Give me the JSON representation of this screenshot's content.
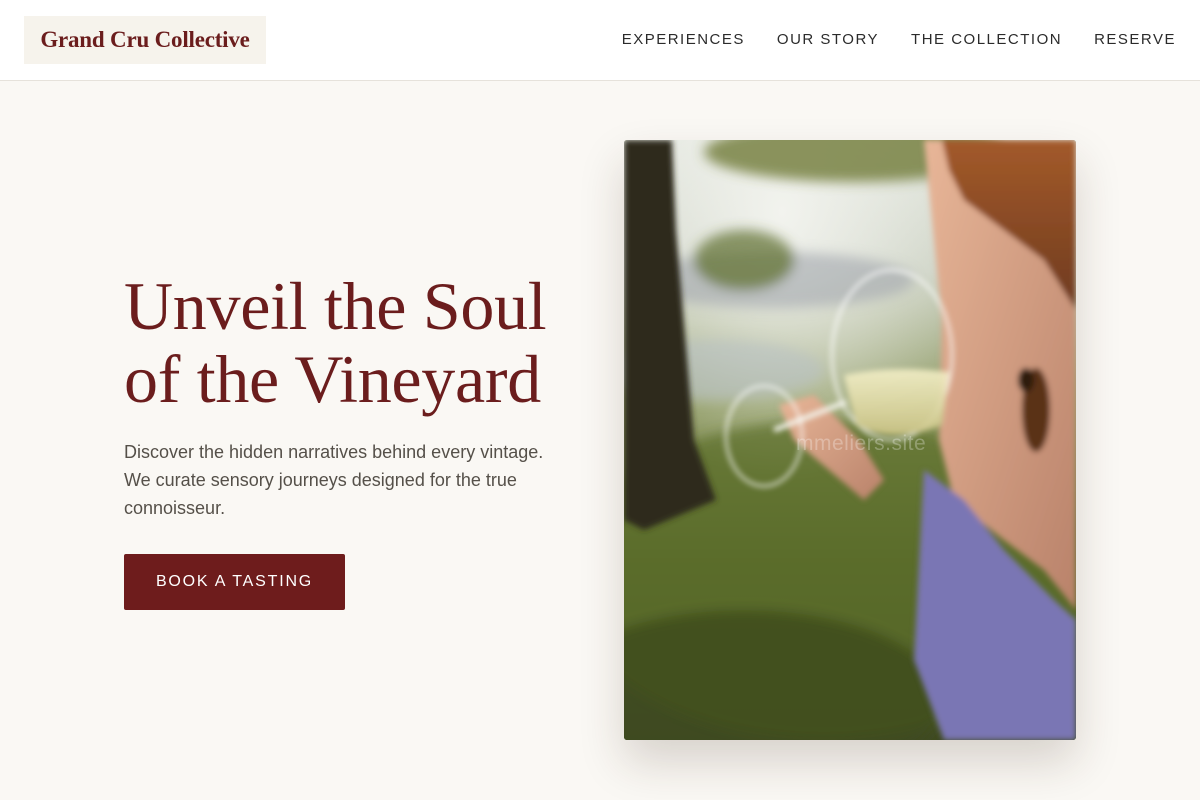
{
  "brand": {
    "name": "Grand Cru Collective",
    "color": "#6b1d1d"
  },
  "nav": {
    "items": [
      {
        "label": "EXPERIENCES"
      },
      {
        "label": "OUR STORY"
      },
      {
        "label": "THE COLLECTION"
      },
      {
        "label": "RESERVE"
      }
    ]
  },
  "hero": {
    "title_line1": "Unveil the Soul",
    "title_line2": "of the Vineyard",
    "subtitle": "Discover the hidden narratives behind every vintage. We curate sensory journeys designed for the true connoisseur.",
    "cta_label": "BOOK A TASTING",
    "cta_color": "#6e1c1c",
    "background": "#faf8f4"
  },
  "image": {
    "subject": "woman-drinking-white-wine-outdoors",
    "watermark": "mmeliers.site"
  }
}
